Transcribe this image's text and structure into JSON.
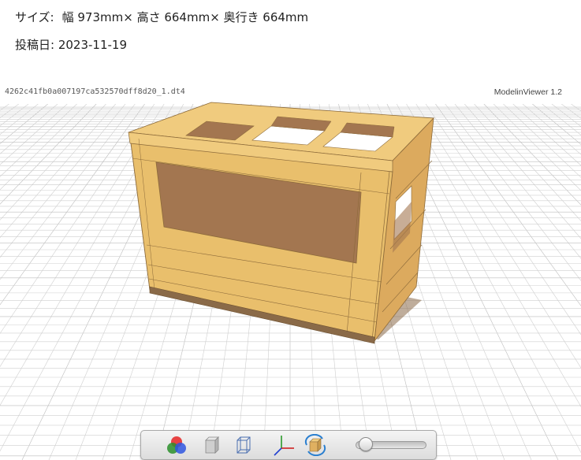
{
  "info": {
    "size_label": "サイズ:",
    "size_value": "幅 973mm× 高さ 664mm× 奥行き 664mm",
    "date_label": "投稿日:",
    "date_value": "2023-11-19"
  },
  "viewer": {
    "file_name": "4262c41fb0a007197ca532570dff8d20_1.dt4",
    "app_version": "ModelinViewer 1.2",
    "model_color": "#e9bf6c",
    "interior_color": "#a37650"
  },
  "toolbar": {
    "buttons": [
      {
        "icon": "color-mode-icon"
      },
      {
        "icon": "solid-view-icon"
      },
      {
        "icon": "wireframe-view-icon"
      },
      {
        "icon": "axis-icon"
      },
      {
        "icon": "rotate-icon"
      }
    ],
    "slider_value": 0.12
  }
}
